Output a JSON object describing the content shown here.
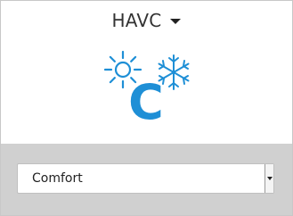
{
  "header": {
    "title": "HAVC",
    "dropdown_icon": "caret-down-icon"
  },
  "status": {
    "mode_letter": "C",
    "icons": [
      "sun-icon",
      "snowflake-icon"
    ],
    "accent_color": "#1e8fd6"
  },
  "mode_select": {
    "selected": "Comfort",
    "handle_icon": "caret-down-icon"
  }
}
